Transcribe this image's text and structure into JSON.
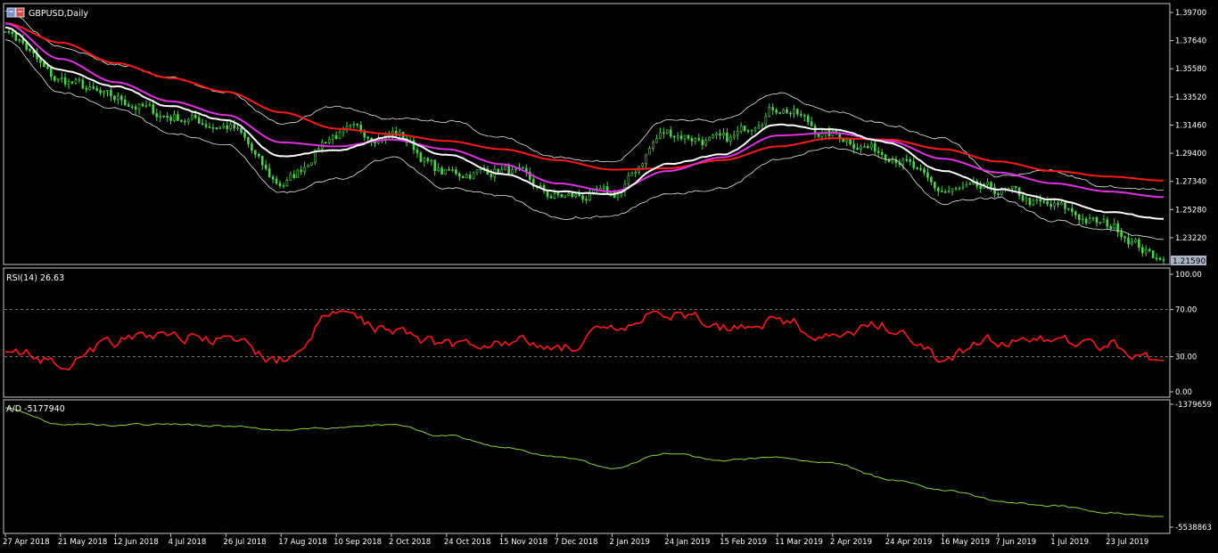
{
  "colors": {
    "background": "#000000",
    "frame": "#c8c8c8",
    "candle": "#4ed34e",
    "ma_fast": "#ffffff",
    "ma_mid": "#e030e0",
    "ma_slow": "#ff1a1a",
    "bands": "#e8e8e8",
    "rsi": "#ff1a1a",
    "ad": "#8bd23c",
    "price_tag_bg": "#aab4c4",
    "price_tag_text": "#000000"
  },
  "main": {
    "symbol_icon": "chart-window-icon",
    "symbol_label": "GBPUSD,Daily",
    "price_ticks": [
      "1.39700",
      "1.37640",
      "1.35580",
      "1.33520",
      "1.31460",
      "1.29400",
      "1.27340",
      "1.25280",
      "1.23220"
    ],
    "current_price": "1.21590"
  },
  "rsi": {
    "label": "RSI(14) 26.63",
    "ticks": [
      "100.00",
      "70.00",
      "30.00",
      "0.00"
    ]
  },
  "ad": {
    "label": "A/D -5177940",
    "ticks": [
      "-1379659",
      "-5538863"
    ]
  },
  "x_axis": {
    "labels": [
      "27 Apr 2018",
      "21 May 2018",
      "12 Jun 2018",
      "4 Jul 2018",
      "26 Jul 2018",
      "17 Aug 2018",
      "10 Sep 2018",
      "2 Oct 2018",
      "24 Oct 2018",
      "15 Nov 2018",
      "7 Dec 2018",
      "2 Jan 2019",
      "24 Jan 2019",
      "15 Feb 2019",
      "11 Mar 2019",
      "2 Apr 2019",
      "24 Apr 2019",
      "16 May 2019",
      "7 Jun 2019",
      "1 Jul 2019",
      "23 Jul 2019"
    ]
  },
  "chart_data": [
    {
      "type": "line",
      "panel": "price",
      "title": "GBPUSD,Daily",
      "x": [
        "27 Apr 2018",
        "21 May 2018",
        "12 Jun 2018",
        "4 Jul 2018",
        "26 Jul 2018",
        "17 Aug 2018",
        "10 Sep 2018",
        "2 Oct 2018",
        "24 Oct 2018",
        "15 Nov 2018",
        "7 Dec 2018",
        "2 Jan 2019",
        "24 Jan 2019",
        "15 Feb 2019",
        "11 Mar 2019",
        "2 Apr 2019",
        "24 Apr 2019",
        "16 May 2019",
        "7 Jun 2019",
        "1 Jul 2019",
        "23 Jul 2019",
        "31 Jul 2019"
      ],
      "ylim": [
        1.2159,
        1.397
      ],
      "series": [
        {
          "role": "close",
          "values": [
            1.383,
            1.347,
            1.333,
            1.321,
            1.314,
            1.272,
            1.308,
            1.309,
            1.279,
            1.282,
            1.262,
            1.263,
            1.309,
            1.302,
            1.328,
            1.307,
            1.295,
            1.266,
            1.266,
            1.254,
            1.241,
            1.216
          ]
        },
        {
          "role": "ma_fast",
          "values": [
            1.386,
            1.355,
            1.343,
            1.328,
            1.318,
            1.292,
            1.296,
            1.306,
            1.293,
            1.279,
            1.266,
            1.264,
            1.286,
            1.293,
            1.315,
            1.311,
            1.302,
            1.281,
            1.268,
            1.26,
            1.251,
            1.246
          ]
        },
        {
          "role": "ma_mid",
          "values": [
            1.389,
            1.363,
            1.346,
            1.332,
            1.322,
            1.302,
            1.299,
            1.304,
            1.297,
            1.286,
            1.272,
            1.266,
            1.281,
            1.291,
            1.307,
            1.309,
            1.303,
            1.29,
            1.28,
            1.272,
            1.266,
            1.262
          ]
        },
        {
          "role": "ma_slow",
          "values": [
            1.389,
            1.375,
            1.36,
            1.349,
            1.339,
            1.324,
            1.312,
            1.308,
            1.303,
            1.297,
            1.289,
            1.282,
            1.283,
            1.289,
            1.299,
            1.305,
            1.304,
            1.297,
            1.288,
            1.281,
            1.277,
            1.274
          ]
        },
        {
          "role": "band_upper",
          "values": [
            1.398,
            1.373,
            1.359,
            1.349,
            1.338,
            1.316,
            1.328,
            1.319,
            1.318,
            1.305,
            1.29,
            1.288,
            1.318,
            1.318,
            1.339,
            1.324,
            1.315,
            1.305,
            1.277,
            1.281,
            1.269,
            1.267
          ]
        },
        {
          "role": "band_lower",
          "values": [
            1.377,
            1.339,
            1.327,
            1.309,
            1.3,
            1.265,
            1.275,
            1.291,
            1.269,
            1.262,
            1.247,
            1.248,
            1.265,
            1.268,
            1.29,
            1.298,
            1.291,
            1.258,
            1.261,
            1.245,
            1.237,
            1.231
          ]
        }
      ]
    },
    {
      "type": "line",
      "panel": "rsi",
      "title": "RSI(14) 26.63",
      "x": [
        "27 Apr 2018",
        "21 May 2018",
        "12 Jun 2018",
        "4 Jul 2018",
        "26 Jul 2018",
        "17 Aug 2018",
        "10 Sep 2018",
        "2 Oct 2018",
        "24 Oct 2018",
        "15 Nov 2018",
        "7 Dec 2018",
        "2 Jan 2019",
        "24 Jan 2019",
        "15 Feb 2019",
        "11 Mar 2019",
        "2 Apr 2019",
        "24 Apr 2019",
        "16 May 2019",
        "7 Jun 2019",
        "1 Jul 2019",
        "23 Jul 2019",
        "31 Jul 2019"
      ],
      "ylim": [
        0,
        100
      ],
      "levels": [
        30,
        70
      ],
      "values": [
        34,
        26,
        43,
        49,
        43,
        27,
        66,
        54,
        40,
        44,
        38,
        50,
        68,
        55,
        62,
        46,
        56,
        28,
        44,
        44,
        41,
        26.63
      ]
    },
    {
      "type": "line",
      "panel": "ad",
      "title": "A/D -5177940",
      "x": [
        "27 Apr 2018",
        "21 May 2018",
        "12 Jun 2018",
        "4 Jul 2018",
        "26 Jul 2018",
        "17 Aug 2018",
        "10 Sep 2018",
        "2 Oct 2018",
        "24 Oct 2018",
        "15 Nov 2018",
        "7 Dec 2018",
        "2 Jan 2019",
        "24 Jan 2019",
        "15 Feb 2019",
        "11 Mar 2019",
        "2 Apr 2019",
        "24 Apr 2019",
        "16 May 2019",
        "7 Jun 2019",
        "1 Jul 2019",
        "23 Jul 2019",
        "31 Jul 2019"
      ],
      "ylim": [
        -5538863,
        -1379659
      ],
      "values": [
        -1500000,
        -2050000,
        -2080000,
        -2060000,
        -2120000,
        -2230000,
        -2200000,
        -2060000,
        -2450000,
        -2850000,
        -3150000,
        -3520000,
        -3050000,
        -3280000,
        -3160000,
        -3380000,
        -3900000,
        -4270000,
        -4650000,
        -4830000,
        -5050000,
        -5177940
      ]
    }
  ]
}
